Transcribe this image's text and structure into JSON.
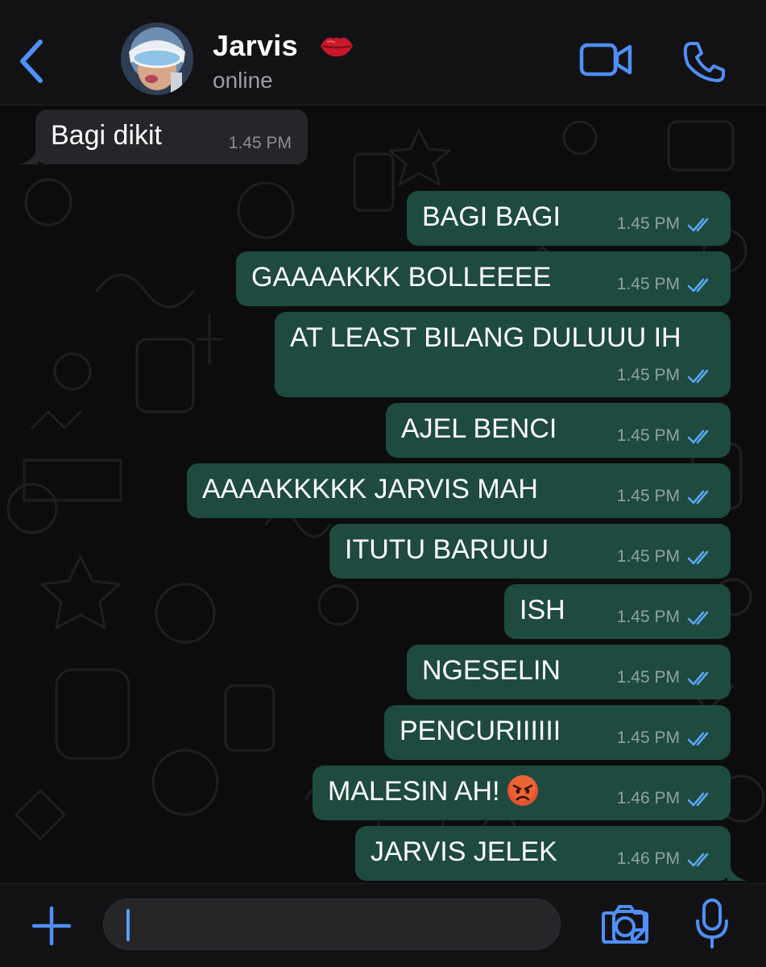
{
  "header": {
    "contact_name": "Jarvis",
    "status": "online",
    "name_emoji": "lips-icon",
    "icons": {
      "back": "chevron-left-icon",
      "video": "video-camera-icon",
      "call": "phone-icon"
    }
  },
  "colors": {
    "accent": "#4f8ff7",
    "outgoing_bubble": "#1e4a3f",
    "incoming_bubble": "#26262a",
    "read_ticks": "#5aa7f2",
    "header_bg": "#121214"
  },
  "messages": [
    {
      "direction": "incoming",
      "text": "Bagi dikit",
      "time": "1.45 PM"
    },
    {
      "direction": "outgoing",
      "text": "BAGI BAGI",
      "time": "1.45 PM",
      "status": "read"
    },
    {
      "direction": "outgoing",
      "text": "GAAAAKKK BOLLEEEE",
      "time": "1.45 PM",
      "status": "read"
    },
    {
      "direction": "outgoing",
      "text": "AT LEAST BILANG DULUUU IH",
      "time": "1.45 PM",
      "status": "read"
    },
    {
      "direction": "outgoing",
      "text": "AJEL BENCI",
      "time": "1.45 PM",
      "status": "read"
    },
    {
      "direction": "outgoing",
      "text": "AAAAKKKKK JARVIS MAH",
      "time": "1.45 PM",
      "status": "read"
    },
    {
      "direction": "outgoing",
      "text": "ITUTU BARUUU",
      "time": "1.45 PM",
      "status": "read"
    },
    {
      "direction": "outgoing",
      "text": "ISH",
      "time": "1.45 PM",
      "status": "read"
    },
    {
      "direction": "outgoing",
      "text": "NGESELIN",
      "time": "1.45 PM",
      "status": "read"
    },
    {
      "direction": "outgoing",
      "text": "PENCURIIIIII",
      "time": "1.45 PM",
      "status": "read"
    },
    {
      "direction": "outgoing",
      "text": "MALESIN AH!",
      "emoji": "angry-face-icon",
      "time": "1.46 PM",
      "status": "read"
    },
    {
      "direction": "outgoing",
      "text": "JARVIS JELEK",
      "time": "1.46 PM",
      "status": "read"
    }
  ],
  "composer": {
    "value": "",
    "placeholder": "",
    "icons": {
      "add": "plus-icon",
      "sticker": "sticker-icon",
      "camera": "camera-icon",
      "mic": "microphone-icon"
    }
  }
}
